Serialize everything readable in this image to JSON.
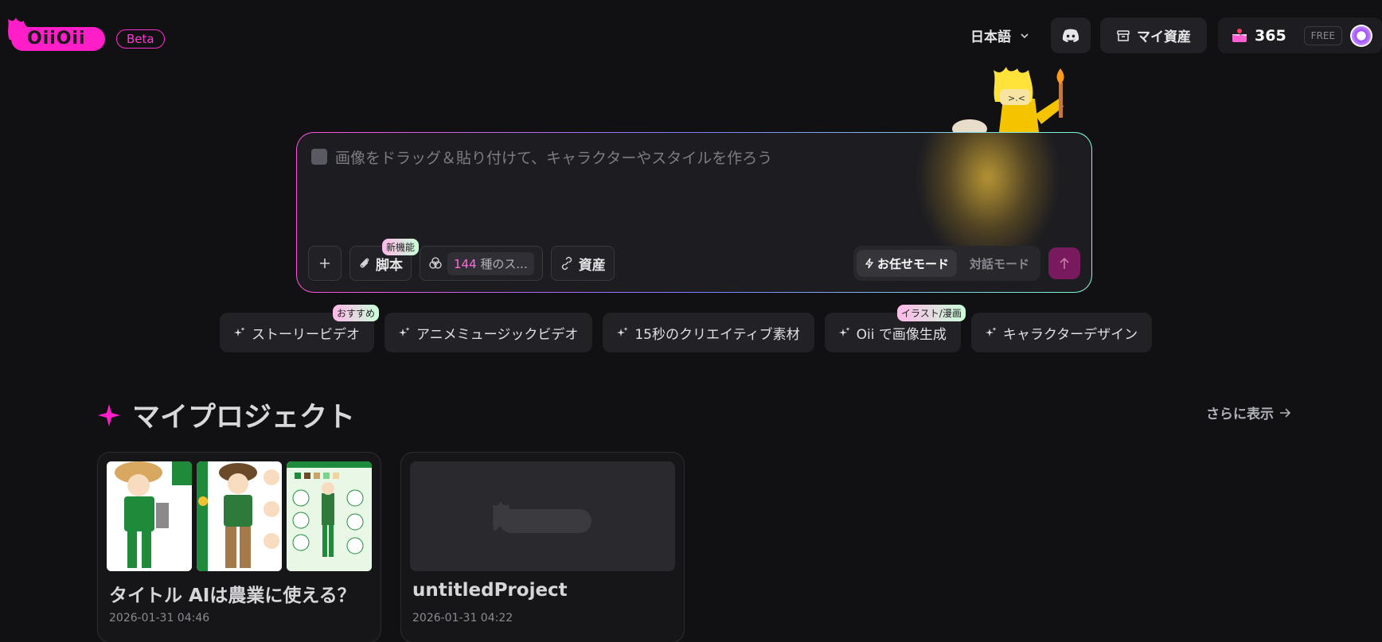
{
  "header": {
    "logo_text": "OiiOii",
    "beta_label": "Beta",
    "language": "日本語",
    "assets_label": "マイ資産",
    "credits": "365",
    "plan": "FREE"
  },
  "prompt": {
    "placeholder": "画像をドラッグ＆貼り付けて、キャラクターやスタイルを作ろう",
    "script_label": "脚本",
    "script_badge": "新機能",
    "style_count": "144",
    "style_suffix": " 種のス...",
    "assets_label": "資産",
    "mode_auto": "お任せモード",
    "mode_chat": "対話モード"
  },
  "suggestions": [
    {
      "label": "ストーリービデオ",
      "badge": "おすすめ"
    },
    {
      "label": "アニメミュージックビデオ",
      "badge": ""
    },
    {
      "label": "15秒のクリエイティブ素材",
      "badge": ""
    },
    {
      "label": "Oii で画像生成",
      "badge": "イラスト/漫画"
    },
    {
      "label": "キャラクターデザイン",
      "badge": ""
    }
  ],
  "projects": {
    "title": "マイプロジェクト",
    "more_label": "さらに表示",
    "items": [
      {
        "title": "タイトル AIは農業に使える？",
        "date": "2026-01-31 04:46"
      },
      {
        "title": "untitledProject",
        "date": "2026-01-31 04:22"
      }
    ]
  },
  "colors": {
    "brand": "#ff1ec8",
    "background": "#111114",
    "send": "#7a1a5e"
  }
}
